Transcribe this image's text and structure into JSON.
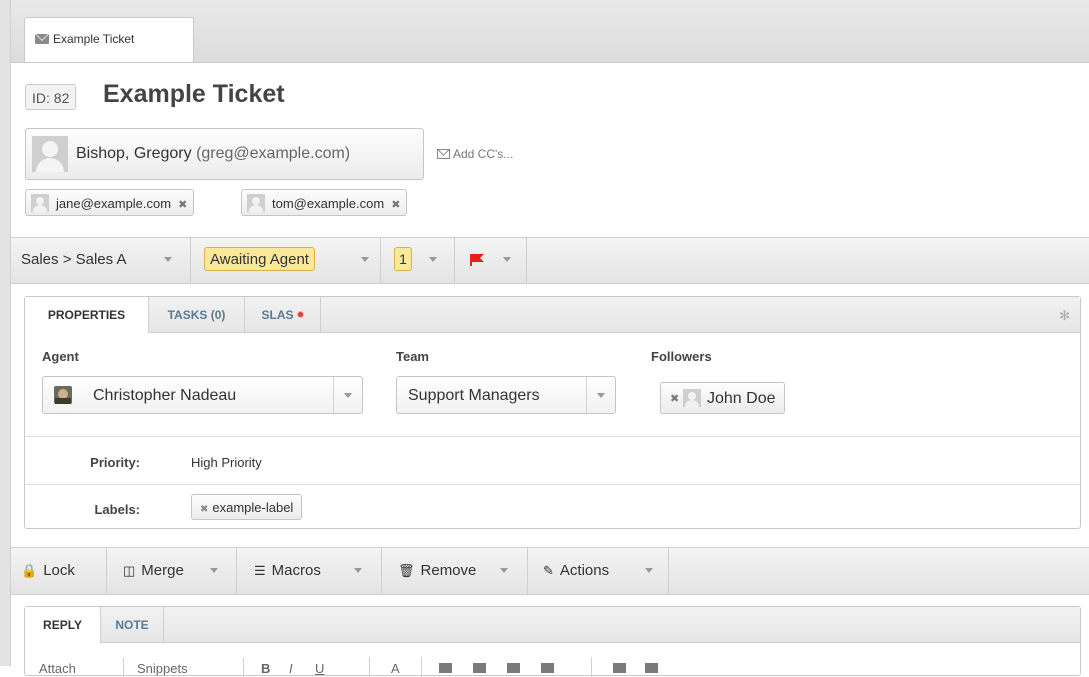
{
  "tab": {
    "label": "Example Ticket",
    "icon": "envelope"
  },
  "ticket": {
    "id_label": "ID: 82",
    "title": "Example Ticket"
  },
  "requester": {
    "name": "Bishop, Gregory",
    "email": "(greg@example.com)",
    "add_cc": "Add CC's..."
  },
  "cc": [
    {
      "email": "jane@example.com",
      "remove": "✖"
    },
    {
      "email": "tom@example.com",
      "remove": "✖"
    }
  ],
  "status_bar": {
    "department": "Sales > Sales A",
    "status": "Awaiting Agent",
    "urgency": "1",
    "flag_color": "#e8201c"
  },
  "properties": {
    "tabs": [
      "PROPERTIES",
      "TASKS (0)",
      "SLAS"
    ],
    "active_tab": "PROPERTIES",
    "agent_label": "Agent",
    "agent_value": "Christopher Nadeau",
    "team_label": "Team",
    "team_value": "Support Managers",
    "followers_label": "Followers",
    "followers": [
      {
        "name": "John Doe",
        "remove": "✖"
      }
    ],
    "priority_label": "Priority:",
    "priority_value": "High Priority",
    "labels_label": "Labels:",
    "labels": [
      {
        "name": "example-label",
        "remove": "✖"
      }
    ]
  },
  "actions": {
    "lock": "Lock",
    "merge": "Merge",
    "macros": "Macros",
    "remove": "Remove",
    "actions": "Actions"
  },
  "reply": {
    "tabs": [
      "REPLY",
      "NOTE"
    ],
    "active_tab": "REPLY",
    "toolbar_visible": [
      "Attach",
      "Snippets",
      "B",
      "I",
      "U",
      "A"
    ]
  },
  "colors": {
    "status_highlight": "#fbe89a",
    "tab_link": "#5a7a92",
    "sla_dot": "#e23b3b"
  }
}
